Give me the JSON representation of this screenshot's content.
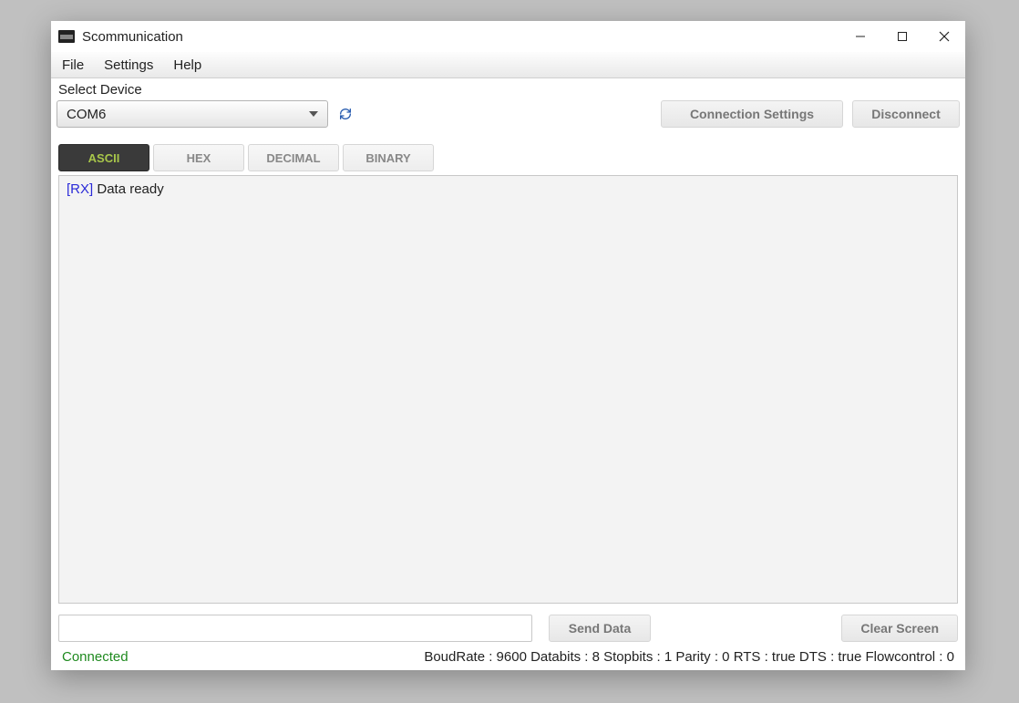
{
  "window": {
    "title": "Scommunication"
  },
  "menu": {
    "file": "File",
    "settings": "Settings",
    "help": "Help"
  },
  "device": {
    "label": "Select Device",
    "selected": "COM6"
  },
  "buttons": {
    "connection_settings": "Connection Settings",
    "disconnect": "Disconnect",
    "send_data": "Send Data",
    "clear_screen": "Clear Screen"
  },
  "tabs": {
    "ascii": "ASCII",
    "hex": "HEX",
    "decimal": "DECIMAL",
    "binary": "BINARY"
  },
  "log": {
    "prefix": "[RX]",
    "message": "Data ready"
  },
  "input": {
    "value": ""
  },
  "status": {
    "connection": "Connected",
    "params": "BoudRate : 9600 Databits : 8 Stopbits : 1 Parity : 0 RTS : true DTS : true Flowcontrol : 0"
  }
}
